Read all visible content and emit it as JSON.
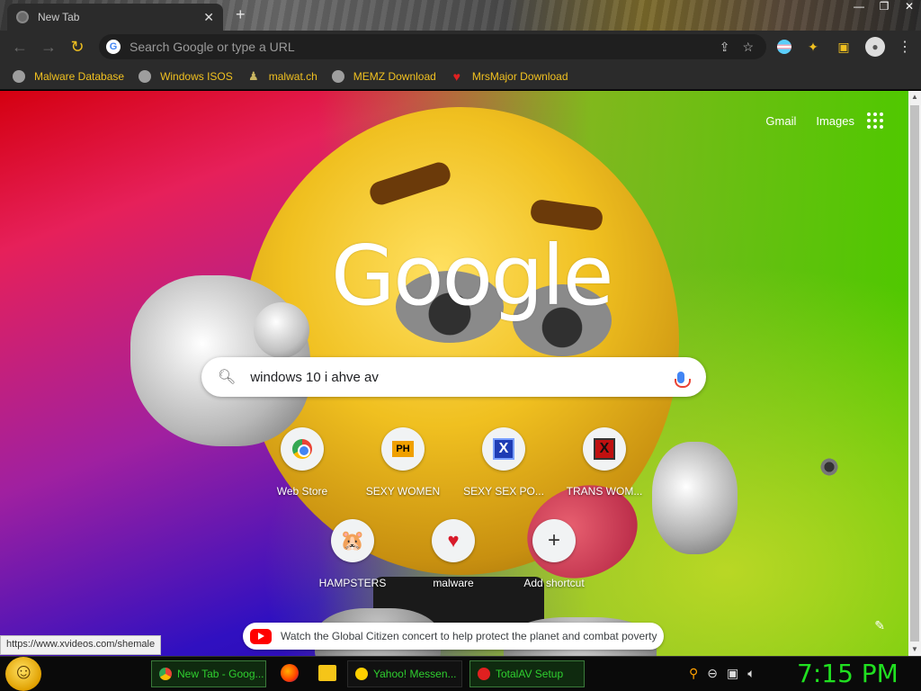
{
  "tab": {
    "title": "New Tab",
    "close": "✕",
    "new": "+"
  },
  "window": {
    "minimize": "—",
    "maximize": "❐",
    "close": "✕"
  },
  "toolbar": {
    "back": "←",
    "forward": "→",
    "reload": "↻",
    "omnibox_placeholder": "Search Google or type a URL",
    "share_icon": "⇪",
    "star_icon": "☆"
  },
  "bookmarks": [
    {
      "label": "Malware Database",
      "icon": "globe-icon"
    },
    {
      "label": "Windows ISOS",
      "icon": "globe-icon"
    },
    {
      "label": "malwat.ch",
      "icon": "user-icon"
    },
    {
      "label": "MEMZ Download",
      "icon": "globe-icon"
    },
    {
      "label": "MrsMajor Download",
      "icon": "heart-icon"
    }
  ],
  "newtab": {
    "links": {
      "gmail": "Gmail",
      "images": "Images"
    },
    "logo": "Google",
    "search_query": "windows 10 i ahve av",
    "shortcuts_row1": [
      {
        "label": "Web Store",
        "icon": "web-store-icon"
      },
      {
        "label": "SEXY WOMEN",
        "icon": "ph-icon",
        "icon_text": "PH"
      },
      {
        "label": "SEXY SEX PO...",
        "icon": "x-blue-icon",
        "icon_text": "X"
      },
      {
        "label": "TRANS WOM...",
        "icon": "x-red-icon",
        "icon_text": "X"
      }
    ],
    "shortcuts_row2": [
      {
        "label": "HAMPSTERS",
        "icon": "hamster-icon",
        "icon_text": "🐹"
      },
      {
        "label": "malware",
        "icon": "heart-icon",
        "icon_text": "♥"
      },
      {
        "label": "Add shortcut",
        "icon": "plus-icon",
        "icon_text": "+"
      }
    ],
    "promo": "Watch the Global Citizen concert to help protect the planet and combat poverty"
  },
  "status_url": "https://www.xvideos.com/shemale",
  "taskbar": {
    "buttons": [
      {
        "label": "New Tab - Goog...",
        "icon": "chrome-icon",
        "active": true
      },
      {
        "label": "Yahoo! Messen...",
        "icon": "yahoo-icon",
        "active": false
      },
      {
        "label": "TotalAV Setup",
        "icon": "totalav-icon",
        "active": true
      }
    ],
    "clock": "7:15 PM"
  },
  "colors": {
    "accent_yellow": "#f0c020",
    "clock_green": "#20e020",
    "taskbar_text": "#2fcf2f"
  }
}
